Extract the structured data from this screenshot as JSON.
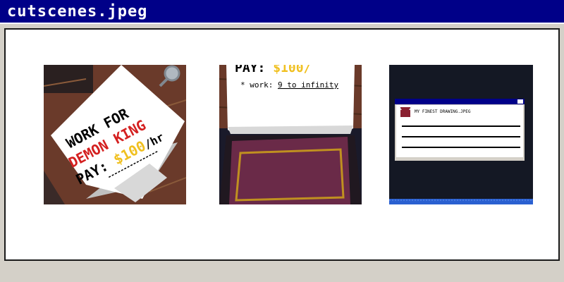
{
  "window": {
    "title": "cutscenes.jpeg"
  },
  "thumbnails": [
    {
      "id": "cutscene-1",
      "line1": "WORK FOR",
      "line2": "DEMON KING",
      "line3a": "PAY: ",
      "line3b": "$100",
      "line3c": "/hr",
      "colors": {
        "red": "#d42020",
        "yellow": "#f0c020",
        "paper": "#ffffff",
        "wood": "#6a3a2a"
      }
    },
    {
      "id": "cutscene-2",
      "pay_label": "PAY: ",
      "pay_value": "$100/",
      "work_prefix": "* work: ",
      "work_value": "9 to infinity",
      "colors": {
        "bed": "#6a2a48",
        "frame": "#c09020",
        "sheet": "#ffffff",
        "floor": "#1a1a2a"
      }
    },
    {
      "id": "cutscene-3",
      "popup_title": "MY FINEST DRAWING.JPEG",
      "colors": {
        "screen": "#141824",
        "titlebar": "#000088",
        "taskbar": "#2a60d0"
      }
    }
  ]
}
